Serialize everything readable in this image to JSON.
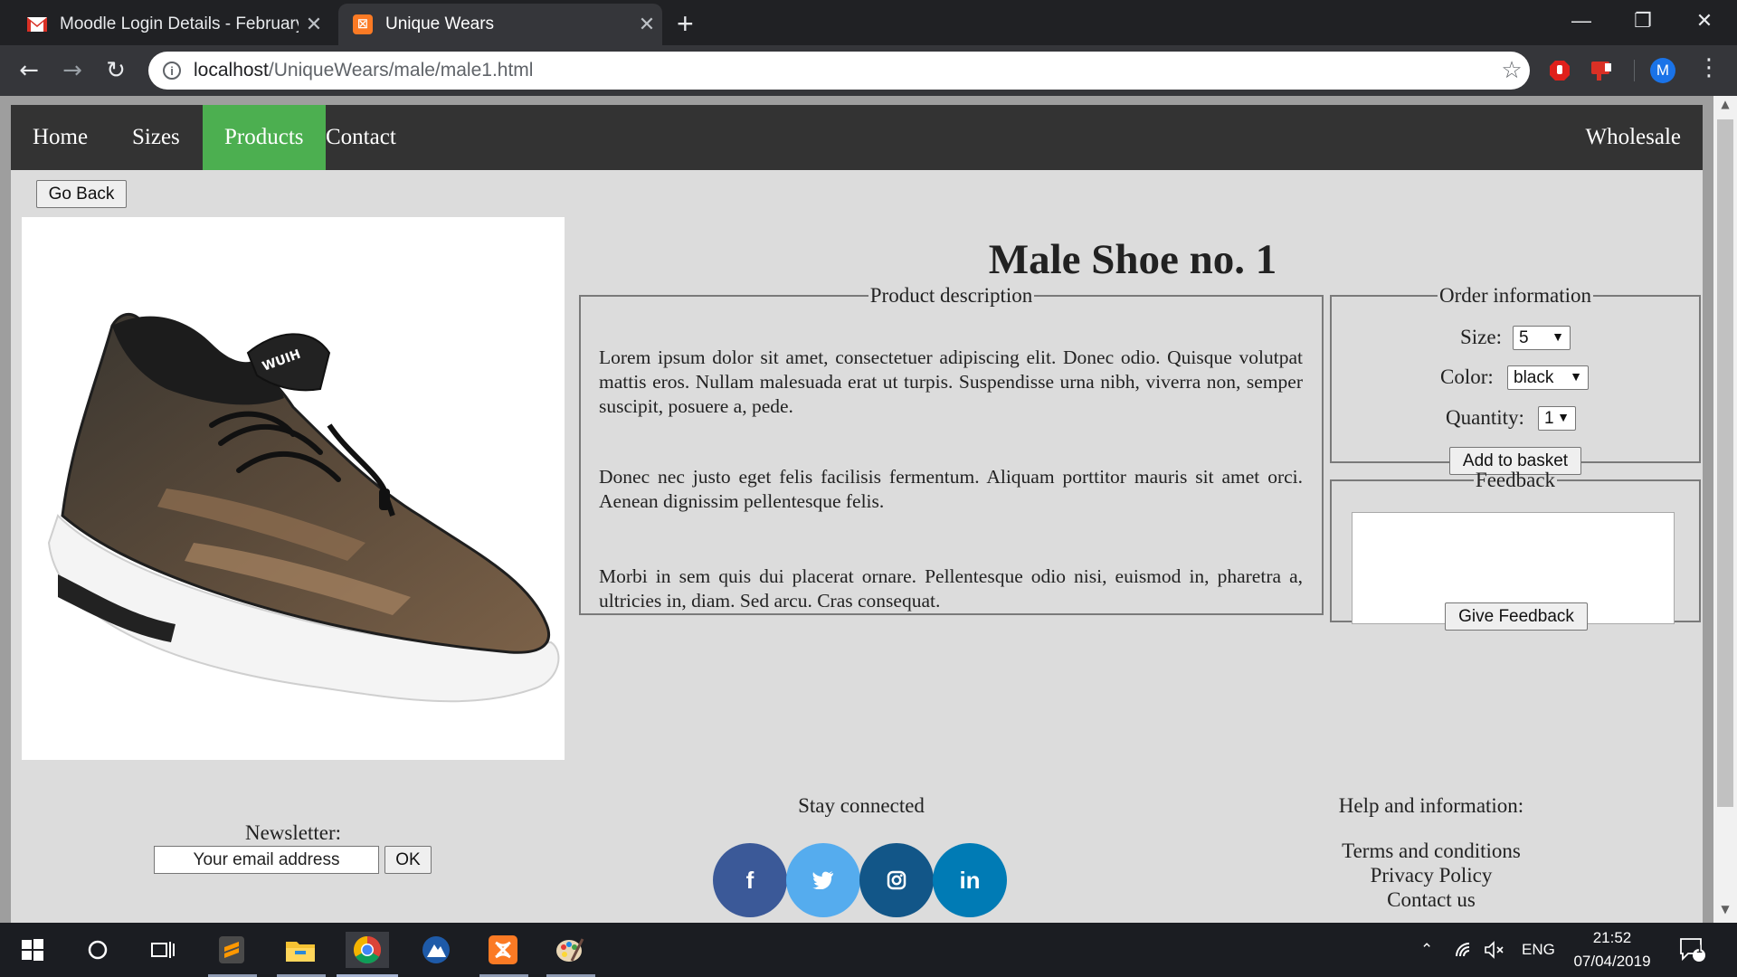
{
  "browser": {
    "tabs": [
      {
        "title": "Moodle Login Details - February",
        "active": false
      },
      {
        "title": "Unique Wears",
        "active": true
      }
    ],
    "url_host": "localhost",
    "url_path": "/UniqueWears/male/male1.html",
    "profile_initial": "M"
  },
  "nav": {
    "items": [
      "Home",
      "Sizes",
      "Products",
      "Contact"
    ],
    "active": "Products",
    "right": "Wholesale"
  },
  "go_back": "Go Back",
  "product": {
    "title": "Male Shoe no. 1",
    "description_legend": "Product description",
    "paragraphs": [
      "Lorem ipsum dolor sit amet, consectetuer adipiscing elit. Donec odio. Quisque volutpat mattis eros. Nullam malesuada erat ut turpis. Suspendisse urna nibh, viverra non, semper suscipit, posuere a, pede.",
      "Donec nec justo eget felis facilisis fermentum. Aliquam porttitor mauris sit amet orci. Aenean dignissim pellentesque felis.",
      "Morbi in sem quis dui placerat ornare. Pellentesque odio nisi, euismod in, pharetra a, ultricies in, diam. Sed arcu. Cras consequat."
    ],
    "image_text": "WUIH"
  },
  "order": {
    "legend": "Order information",
    "size_label": "Size:",
    "size_value": "5",
    "color_label": "Color:",
    "color_value": "black",
    "quantity_label": "Quantity:",
    "quantity_value": "1",
    "add_button": "Add to basket"
  },
  "feedback": {
    "legend": "Feedback",
    "button": "Give Feedback"
  },
  "footer": {
    "newsletter_label": "Newsletter:",
    "email_placeholder": "Your email address",
    "ok": "OK",
    "stay_connected": "Stay connected",
    "social": [
      {
        "name": "facebook",
        "glyph": "f",
        "color": "#3b5998"
      },
      {
        "name": "twitter",
        "glyph": "t",
        "color": "#55acee"
      },
      {
        "name": "instagram",
        "glyph": "ig",
        "color": "#125688"
      },
      {
        "name": "linkedin",
        "glyph": "in",
        "color": "#007bb5"
      }
    ],
    "help_title": "Help and information:",
    "help_links": [
      "Terms and conditions",
      "Privacy Policy",
      "Contact us"
    ]
  },
  "taskbar": {
    "language": "ENG",
    "time": "21:52",
    "date": "07/04/2019",
    "notifications": "1"
  },
  "colors": {
    "nav_bg": "#333333",
    "nav_active": "#4caf50",
    "page_bg": "#dcdcdc"
  }
}
